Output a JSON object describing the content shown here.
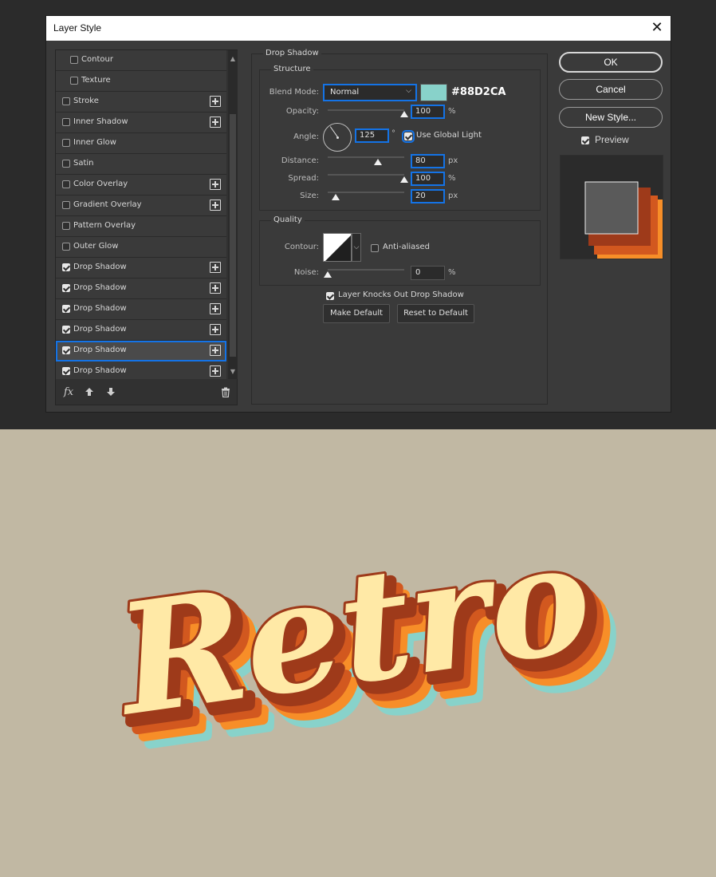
{
  "dialog": {
    "title": "Layer Style",
    "close_label": "✕"
  },
  "styles_list": [
    {
      "label": "Contour",
      "checked": false,
      "plus": false,
      "indent": true
    },
    {
      "label": "Texture",
      "checked": false,
      "plus": false,
      "indent": true
    },
    {
      "label": "Stroke",
      "checked": false,
      "plus": true,
      "indent": false
    },
    {
      "label": "Inner Shadow",
      "checked": false,
      "plus": true,
      "indent": false
    },
    {
      "label": "Inner Glow",
      "checked": false,
      "plus": false,
      "indent": false
    },
    {
      "label": "Satin",
      "checked": false,
      "plus": false,
      "indent": false
    },
    {
      "label": "Color Overlay",
      "checked": false,
      "plus": true,
      "indent": false
    },
    {
      "label": "Gradient Overlay",
      "checked": false,
      "plus": true,
      "indent": false
    },
    {
      "label": "Pattern Overlay",
      "checked": false,
      "plus": false,
      "indent": false
    },
    {
      "label": "Outer Glow",
      "checked": false,
      "plus": false,
      "indent": false
    },
    {
      "label": "Drop Shadow",
      "checked": true,
      "plus": true,
      "indent": false
    },
    {
      "label": "Drop Shadow",
      "checked": true,
      "plus": true,
      "indent": false
    },
    {
      "label": "Drop Shadow",
      "checked": true,
      "plus": true,
      "indent": false
    },
    {
      "label": "Drop Shadow",
      "checked": true,
      "plus": true,
      "indent": false
    },
    {
      "label": "Drop Shadow",
      "checked": true,
      "plus": true,
      "indent": false,
      "selected": true
    },
    {
      "label": "Drop Shadow",
      "checked": true,
      "plus": true,
      "indent": false
    }
  ],
  "list_toolbar": {
    "fx_label": "fx",
    "up_icon": "arrow-up-icon",
    "down_icon": "arrow-down-icon",
    "trash_icon": "trash-icon"
  },
  "drop_shadow": {
    "section_title": "Drop Shadow",
    "structure_title": "Structure",
    "blend_mode_label": "Blend Mode:",
    "blend_mode_value": "Normal",
    "color_hex": "#88D2CA",
    "opacity_label": "Opacity:",
    "opacity_value": "100",
    "opacity_unit": "%",
    "angle_label": "Angle:",
    "angle_value": "125",
    "angle_unit": "°",
    "use_global_light_label": "Use Global Light",
    "use_global_light": true,
    "distance_label": "Distance:",
    "distance_value": "80",
    "distance_unit": "px",
    "spread_label": "Spread:",
    "spread_value": "100",
    "spread_unit": "%",
    "size_label": "Size:",
    "size_value": "20",
    "size_unit": "px",
    "quality_title": "Quality",
    "contour_label": "Contour:",
    "anti_aliased_label": "Anti-aliased",
    "anti_aliased": false,
    "noise_label": "Noise:",
    "noise_value": "0",
    "noise_unit": "%",
    "knockout_label": "Layer Knocks Out Drop Shadow",
    "knockout": true,
    "make_default_label": "Make Default",
    "reset_default_label": "Reset to Default"
  },
  "slider_levels": {
    "opacity": 1.0,
    "distance": 0.66,
    "spread": 1.0,
    "size": 0.1,
    "noise": 0.0
  },
  "right_buttons": {
    "ok_label": "OK",
    "cancel_label": "Cancel",
    "new_style_label": "New Style...",
    "preview_label": "Preview",
    "preview_checked": true
  },
  "colors": {
    "accent": "#1473e6",
    "shadow_teal": "#88D2CA",
    "art_background": "#C1B8A3",
    "text_cream": "#FFE9A6",
    "outline_brown": "#9E3A1A",
    "shadow_orange": "#F78E28",
    "shadow_rust": "#D2581F"
  },
  "artwork": {
    "text": "Retro"
  }
}
